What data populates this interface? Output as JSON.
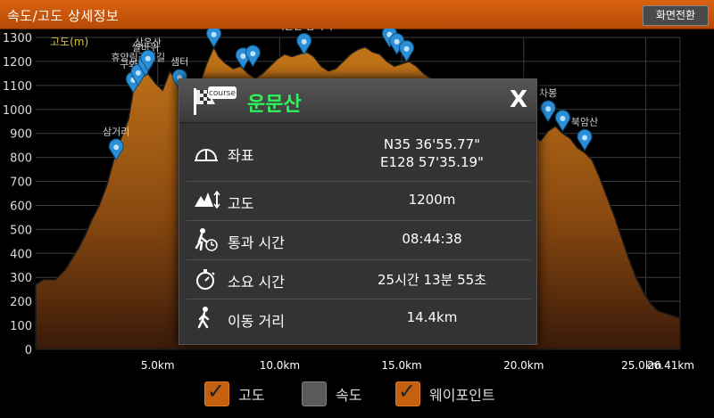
{
  "header": {
    "title": "속도/고도 상세정보",
    "switch_label": "화면전환"
  },
  "chart_data": {
    "type": "area",
    "series_label": "고도(m)",
    "ylim": [
      0,
      1300
    ],
    "y_ticks": [
      0,
      100,
      200,
      300,
      400,
      500,
      600,
      700,
      800,
      900,
      1000,
      1100,
      1200,
      1300
    ],
    "xlim": [
      0,
      26.41
    ],
    "x_ticks": [
      5.0,
      10.0,
      15.0,
      20.0,
      25.0,
      26.41
    ],
    "x_tick_labels": [
      "5.0km",
      "10.0km",
      "15.0km",
      "20.0km",
      "25.0km",
      "26.41km"
    ],
    "grid": true,
    "fill_color": "#b86a14",
    "x": [
      0,
      0.3,
      0.8,
      1.2,
      1.5,
      1.8,
      2.0,
      2.3,
      2.6,
      2.9,
      3.2,
      3.5,
      3.8,
      4.0,
      4.3,
      4.6,
      4.9,
      5.2,
      5.5,
      5.8,
      6.1,
      6.4,
      6.7,
      7.0,
      7.3,
      7.5,
      7.8,
      8.1,
      8.4,
      8.7,
      9.0,
      9.3,
      9.6,
      9.9,
      10.2,
      10.5,
      10.8,
      11.1,
      11.4,
      11.7,
      12.0,
      12.3,
      12.6,
      12.9,
      13.2,
      13.5,
      13.8,
      14.1,
      14.4,
      14.7,
      15.0,
      15.3,
      15.6,
      15.9,
      16.2,
      16.5,
      16.8,
      17.1,
      17.4,
      17.7,
      18.0,
      18.3,
      18.6,
      18.9,
      19.2,
      19.5,
      19.8,
      20.1,
      20.4,
      20.7,
      21.0,
      21.3,
      21.6,
      21.9,
      22.2,
      22.5,
      22.8,
      23.1,
      23.4,
      23.7,
      24.0,
      24.3,
      24.6,
      24.9,
      25.2,
      25.5,
      25.8,
      26.1,
      26.41
    ],
    "y": [
      270,
      290,
      290,
      330,
      380,
      430,
      470,
      540,
      600,
      680,
      790,
      880,
      960,
      1080,
      1130,
      1150,
      1110,
      1080,
      1160,
      1110,
      1070,
      1060,
      1100,
      1190,
      1260,
      1220,
      1190,
      1170,
      1180,
      1150,
      1130,
      1150,
      1180,
      1210,
      1230,
      1220,
      1230,
      1240,
      1220,
      1180,
      1160,
      1170,
      1200,
      1230,
      1250,
      1260,
      1240,
      1230,
      1200,
      1180,
      1190,
      1200,
      1180,
      1150,
      1130,
      1120,
      1110,
      1100,
      1080,
      1060,
      1040,
      1020,
      1000,
      980,
      960,
      950,
      940,
      920,
      890,
      870,
      910,
      930,
      900,
      880,
      840,
      820,
      790,
      720,
      640,
      560,
      470,
      380,
      300,
      240,
      190,
      160,
      150,
      140,
      130
    ]
  },
  "waypoints": [
    {
      "label": "삼거리",
      "x": 3.3,
      "y": 790
    },
    {
      "label": "구봐위",
      "x": 4.0,
      "y": 1070
    },
    {
      "label": "휴양림갈림길",
      "x": 4.2,
      "y": 1100
    },
    {
      "label": "쌀바위",
      "x": 4.5,
      "y": 1140
    },
    {
      "label": "상운산",
      "x": 4.6,
      "y": 1160
    },
    {
      "label": "샘터",
      "x": 5.9,
      "y": 1080
    },
    {
      "label": "북봉",
      "x": 7.3,
      "y": 1260
    },
    {
      "label": "",
      "x": 8.5,
      "y": 1170
    },
    {
      "label": "",
      "x": 8.9,
      "y": 1180
    },
    {
      "label": "백운산 삼거리",
      "x": 11.0,
      "y": 1230
    },
    {
      "label": "상운암 갈림길",
      "x": 14.5,
      "y": 1260
    },
    {
      "label": "",
      "x": 14.8,
      "y": 1230
    },
    {
      "label": "",
      "x": 15.2,
      "y": 1200
    },
    {
      "label": "차봉",
      "x": 21.0,
      "y": 950
    },
    {
      "label": "",
      "x": 21.6,
      "y": 910
    },
    {
      "label": "북암산",
      "x": 22.5,
      "y": 830
    }
  ],
  "legend": [
    {
      "label": "고도",
      "checked": true
    },
    {
      "label": "속도",
      "checked": false
    },
    {
      "label": "웨이포인트",
      "checked": true
    }
  ],
  "dialog": {
    "badge": "course",
    "title": "운문산",
    "close_label": "X",
    "rows": [
      {
        "icon": "compass-icon",
        "label": "좌표",
        "value": "N35 36'55.77\"",
        "value2": "E128 57'35.19\""
      },
      {
        "icon": "mountain-altitude-icon",
        "label": "고도",
        "value": "1200m"
      },
      {
        "icon": "hiker-clock-icon",
        "label": "통과 시간",
        "value": "08:44:38"
      },
      {
        "icon": "stopwatch-icon",
        "label": "소요 시간",
        "value": "25시간 13분 55초"
      },
      {
        "icon": "walking-person-icon",
        "label": "이동 거리",
        "value": "14.4km"
      }
    ]
  }
}
